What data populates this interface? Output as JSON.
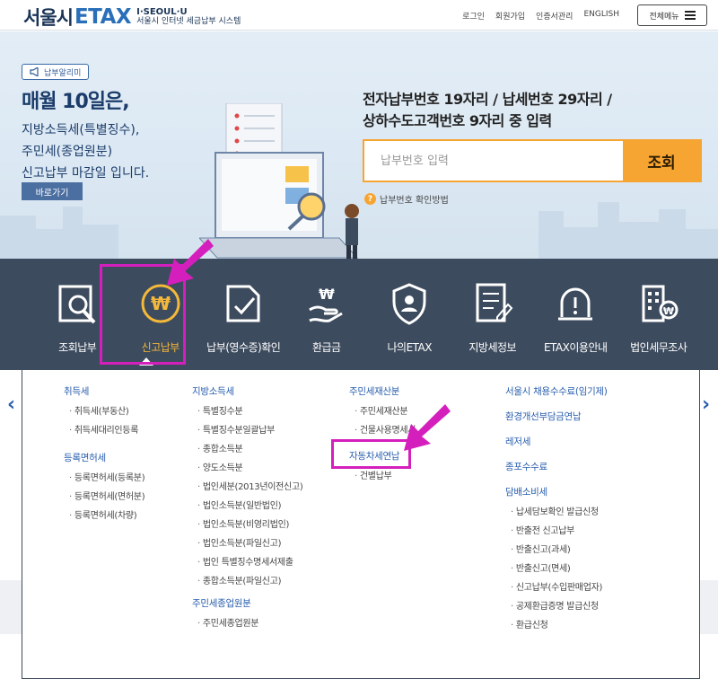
{
  "header": {
    "logo_main": "서울시",
    "logo_etax": "ETAX",
    "logo_sub1": "I·SEOUL·U",
    "logo_sub2": "서울시 인터넷 세금납부 시스템",
    "util_links": [
      "로그인",
      "회원가입",
      "인증서관리",
      "ENGLISH"
    ],
    "menu_label": "전체메뉴"
  },
  "hero": {
    "badge": "납부알리미",
    "title": "매월 10일은,",
    "lines": [
      "지방소득세(특별징수),",
      "주민세(종업원분)",
      "신고납부 마감일 입니다."
    ],
    "go_button": "바로가기",
    "search_title_1": "전자납부번호 19자리 / 납세번호 29자리 /",
    "search_title_2": "상하수도고객번호 9자리 중 입력",
    "search_placeholder": "납부번호 입력",
    "search_button": "조회",
    "help_text": "납부번호 확인방법"
  },
  "nav": {
    "items": [
      {
        "label": "조회납부",
        "icon": "search-document-icon"
      },
      {
        "label": "신고납부",
        "icon": "won-coin-icon"
      },
      {
        "label": "납부(영수증)확인",
        "icon": "check-document-icon"
      },
      {
        "label": "환급금",
        "icon": "won-hand-icon"
      },
      {
        "label": "나의ETAX",
        "icon": "user-shield-icon"
      },
      {
        "label": "지방세정보",
        "icon": "checklist-icon"
      },
      {
        "label": "ETAX이용안내",
        "icon": "alert-icon"
      },
      {
        "label": "법인세무조사",
        "icon": "building-icon"
      }
    ],
    "active_index": 1
  },
  "panel": {
    "col1": {
      "groups": [
        {
          "title": "취득세",
          "items": [
            "취득세(부동산)",
            "취득세대리인등록"
          ]
        },
        {
          "title": "등록면허세",
          "items": [
            "등록면허세(등록분)",
            "등록면허세(면허분)",
            "등록면허세(차량)"
          ]
        }
      ]
    },
    "col2": {
      "groups": [
        {
          "title": "지방소득세",
          "items": [
            "특별징수분",
            "특별징수분일괄납부",
            "종합소득분",
            "양도소득분",
            "법인세분(2013년이전신고)",
            "법인소득분(일반법인)",
            "법인소득분(비영리법인)",
            "법인소득분(파일신고)",
            "법인 특별징수명세서제출",
            "종합소득분(파일신고)"
          ]
        },
        {
          "title": "주민세종업원분",
          "items": [
            "주민세종업원분"
          ]
        }
      ]
    },
    "col3": {
      "groups": [
        {
          "title": "주민세재산분",
          "items": [
            "주민세재산분",
            "건물사용명세서"
          ]
        },
        {
          "title": "자동차세연납",
          "items": [
            "건별납부"
          ]
        }
      ]
    },
    "col4": {
      "groups": [
        {
          "title": "서울시 채용수수료(임기제)",
          "items": []
        },
        {
          "title": "환경개선부담금연납",
          "items": []
        },
        {
          "title": "레저세",
          "items": []
        },
        {
          "title": "종포수수료",
          "items": []
        },
        {
          "title": "담배소비세",
          "items": [
            "납세담보확인 발급신청",
            "반출전 신고납부",
            "반출신고(과세)",
            "반출신고(면세)",
            "신고납부(수입판매업자)",
            "공제환급증명 발급신청",
            "환급신청"
          ]
        }
      ]
    }
  },
  "colors": {
    "nav_bg": "#3d4b5e",
    "accent_orange": "#f7a532",
    "link_blue": "#2a5fae",
    "annotation_magenta": "#d41fbd"
  }
}
